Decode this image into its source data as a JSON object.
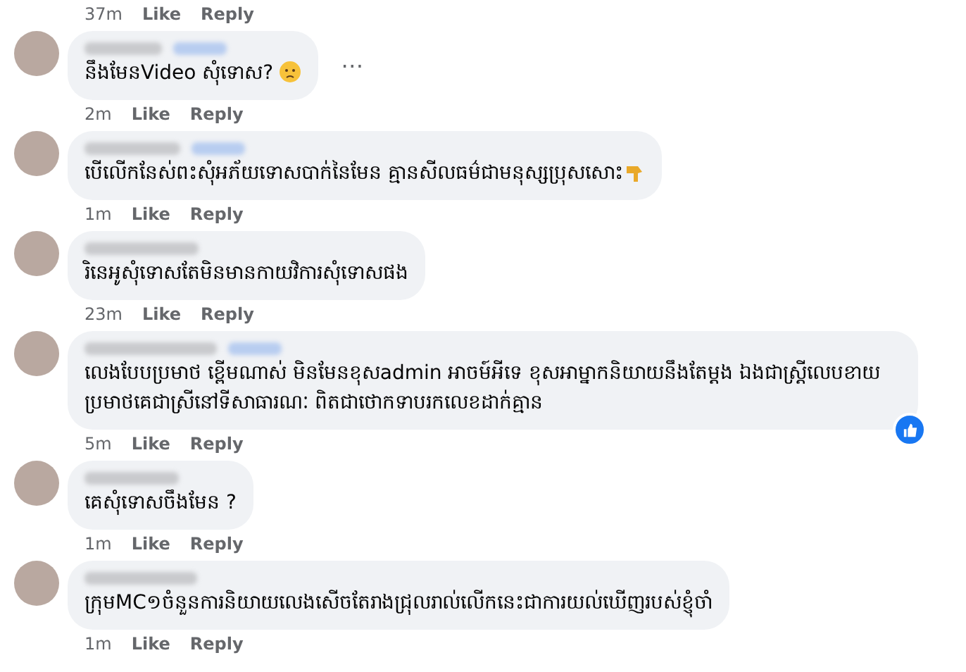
{
  "top_meta": {
    "time": "37m",
    "actions": [
      "Like",
      "Reply"
    ]
  },
  "comments": [
    {
      "follow": true,
      "text": "នឹងមែនVideo សុំទោស?",
      "emoji": {
        "kind": "sad-face"
      },
      "more": "…",
      "reaction": false,
      "time": "2m",
      "actions": [
        "Like",
        "Reply"
      ]
    },
    {
      "follow": true,
      "text": "បើលើកនែស់ពះសុំអភ័យទោសបាក់នៃមែន គ្មានសីលធម៌ជាមនុស្សប្រុសសោះ",
      "emoji": {
        "kind": "thumb-down"
      },
      "reaction": false,
      "time": "1m",
      "actions": [
        "Like",
        "Reply"
      ]
    },
    {
      "follow": false,
      "text": "រិនេអូសុំទោសតែមិនមានកាយវិការសុំទោសផង",
      "reaction": false,
      "time": "23m",
      "actions": [
        "Like",
        "Reply"
      ]
    },
    {
      "follow": true,
      "text": "លេងបែបប្រមាថ ខ្ពើមណាស់ មិនមែនខុសadmin អាចម៍អីទេ ខុសអាម្នាកនិយាយនឹងតែម្តង ឯងជាស្ត្រីលេបខាយប្រមាថគេជាស្រីនៅទីសាធារណៈ ពិតជាថោកទាបរកលេខដាក់គ្មាន",
      "reaction": true,
      "time": "5m",
      "actions": [
        "Like",
        "Reply"
      ]
    },
    {
      "follow": false,
      "text": "គេសុំទោសចឹងមែន ?",
      "reaction": false,
      "time": "1m",
      "actions": [
        "Like",
        "Reply"
      ]
    },
    {
      "follow": false,
      "text": "ក្រុមMC១ចំនួនការនិយាយលេងសើចតែរាងជ្រុលរាល់លើកនេះជាការយល់ឃើញរបស់ខ្ញុំចាំ",
      "reaction": false,
      "time": "1m",
      "actions": [
        "Like",
        "Reply"
      ]
    }
  ]
}
